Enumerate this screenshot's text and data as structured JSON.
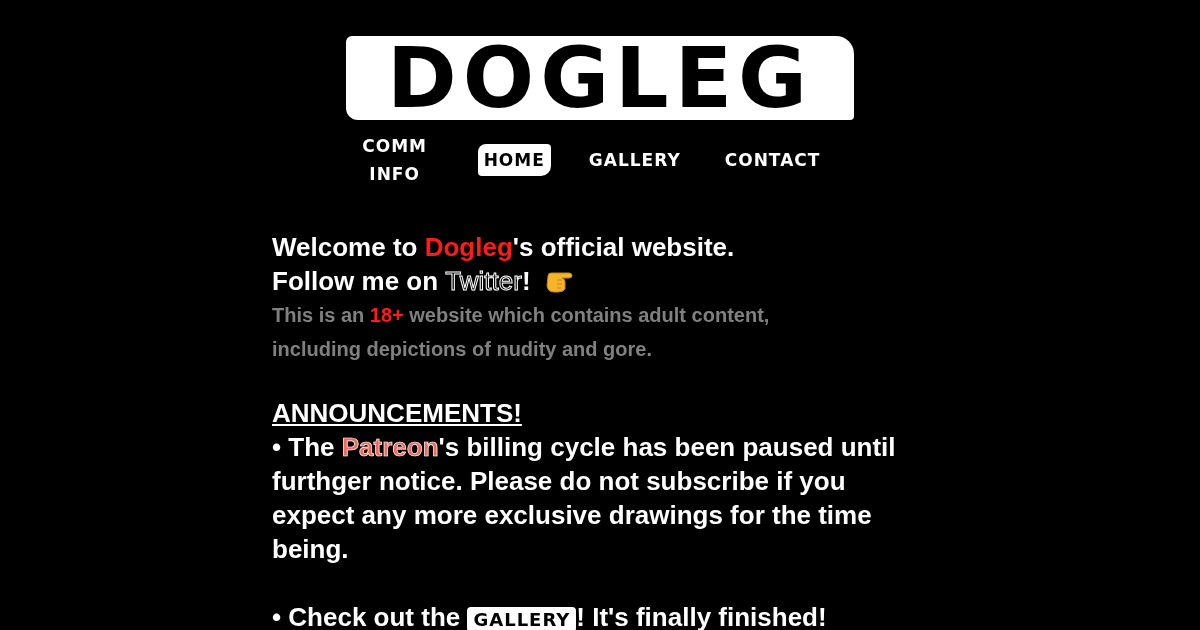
{
  "logo": {
    "text": "DOGLEG"
  },
  "nav": [
    {
      "label": "COMM INFO",
      "selected": false
    },
    {
      "label": "HOME",
      "selected": true
    },
    {
      "label": "GALLERY",
      "selected": false
    },
    {
      "label": "CONTACT",
      "selected": false
    }
  ],
  "welcome": {
    "before": "Welcome to ",
    "highlight": "Dogleg",
    "after": "'s official website."
  },
  "follow": {
    "before": "Follow me on ",
    "link": "Twitter",
    "after": "!"
  },
  "warning": {
    "before": "This is an ",
    "highlight": "18+",
    "after": " website which contains adult content, including depictions of nudity and gore."
  },
  "announcements": {
    "heading": "ANNOUNCEMENTS!",
    "items": [
      {
        "before": "• The ",
        "link": "Patreon",
        "kind": "text-link",
        "after": "'s billing cycle has been paused until furthger notice. Please do not subscribe if you expect any more exclusive drawings for the time being."
      },
      {
        "before": "• Check out the ",
        "link": "GALLERY",
        "kind": "badge-link",
        "after": "! It's finally finished!"
      }
    ]
  }
}
